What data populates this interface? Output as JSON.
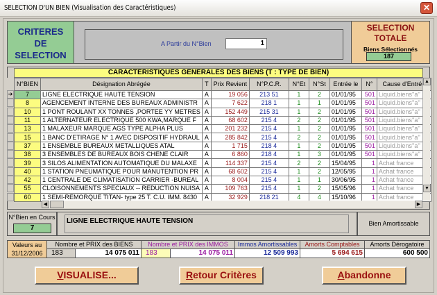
{
  "window": {
    "title": "SELECTION D'UN BIEN  (Visualisation des Caractéristiques)",
    "close_icon": "close-icon"
  },
  "criteria": {
    "title_lines": [
      "CRITERES",
      "DE",
      "SELECTION"
    ],
    "from_label": "A Partir du N°Bien",
    "from_value": "1"
  },
  "selection": {
    "title_lines": [
      "SELECTION",
      "TOTALE"
    ],
    "count_label": "Biens Sélectionnés",
    "count": "187"
  },
  "table": {
    "title": "CARACTERISTIQUES GENERALES DES BIENS (T : TYPE DE BIEN)",
    "columns": [
      "N°BIEN",
      "Désignation Abrégée",
      "T",
      "Prix Revient",
      "N°P.C.R.",
      "N°Et",
      "N°St",
      "Entrée le",
      "N°",
      "Cause d'Entrée"
    ],
    "rows": [
      [
        "7",
        "LIGNE ELECTRIQUE HAUTE TENSION",
        "A",
        "19 056",
        "213 51",
        "1",
        "2",
        "01/01/95",
        "501",
        "Liquid.biens''a''"
      ],
      [
        "8",
        "AGENCEMENT INTERNE DES BUREAUX ADMINISTR",
        "A",
        "7 622",
        "218 1",
        "1",
        "1",
        "01/01/95",
        "501",
        "Liquid.biens''a''"
      ],
      [
        "10",
        "1 PONT ROULANT XX TONNES ,PORTEE YY METRES",
        "A",
        "152 449",
        "215 31",
        "1",
        "2",
        "01/01/95",
        "501",
        "Liquid.biens''a''"
      ],
      [
        "11",
        "1 ALTERNATEUR  ELECTRIQUE 500 KWA,MARQUE F",
        "A",
        "68 602",
        "215 4",
        "2",
        "2",
        "01/01/95",
        "501",
        "Liquid.biens''a''"
      ],
      [
        "13",
        "1 MALAXEUR MARQUE AGS TYPE ALPHA PLUS",
        "A",
        "201 232",
        "215 4",
        "1",
        "2",
        "01/01/95",
        "501",
        "Liquid.biens''a''"
      ],
      [
        "15",
        "1 BANC D'ETIRAGE N° 1 AVEC DISPOSITIF HYDRAUL",
        "A",
        "285 842",
        "215 4",
        "2",
        "2",
        "01/01/95",
        "501",
        "Liquid.biens''a''"
      ],
      [
        "37",
        "1 ENSEMBLE BUREAUX METALLIQUES ATAL",
        "A",
        "1 715",
        "218 4",
        "1",
        "2",
        "01/01/95",
        "501",
        "Liquid.biens''a''"
      ],
      [
        "38",
        "3 ENSEMBLES DE BUREAUX BOIS CHENE CLAIR",
        "A",
        "6 860",
        "218 4",
        "1",
        "3",
        "01/01/95",
        "501",
        "Liquid.biens''a''"
      ],
      [
        "39",
        "3 SILOS ALIMENTATION AUTOMATIQUE DU MALAXE",
        "A",
        "114 337",
        "215 4",
        "2",
        "2",
        "15/04/95",
        "1",
        "Achat france"
      ],
      [
        "40",
        "1 STATION PNEUMATIQUE POUR MANUTENTION PR",
        "A",
        "68 602",
        "215 4",
        "1",
        "2",
        "12/05/95",
        "1",
        "Achat france"
      ],
      [
        "42",
        "1 CENTRALE DE CLIMATISATION CARRIER -BUREAL",
        "A",
        "8 004",
        "215 4",
        "1",
        "1",
        "30/06/95",
        "1",
        "Achat france"
      ],
      [
        "55",
        "CLOISONNEMENTS SPECIAUX  -- REDUCTION NUISA",
        "A",
        "109 763",
        "215 4",
        "1",
        "2",
        "15/05/96",
        "1",
        "Achat france"
      ],
      [
        "60",
        "1 SEMI-REMORQUE TITAN- type 25 T. C.U. IMM. 8430",
        "A",
        "32 929",
        "218 21",
        "4",
        "4",
        "15/10/96",
        "1",
        "Achat france"
      ]
    ]
  },
  "current": {
    "label": "N°Bien en Cours",
    "value": "7",
    "designation": "LIGNE ELECTRIQUE HAUTE TENSION",
    "status": "Bien Amortissable"
  },
  "values": {
    "date_lines": [
      "Valeurs au",
      "31/12/2006"
    ],
    "biens": {
      "header": "Nombre et PRIX des BIENS",
      "count": "183",
      "amount": "14 075 011"
    },
    "immos": {
      "header": "Nombre et PRIX des IMMOS",
      "count": "183",
      "amount": "14 075 011"
    },
    "amortissables": {
      "header": "Immos Amortissables",
      "amount": "12 509 993"
    },
    "comptables": {
      "header": "Amorts Comptables",
      "amount": "5 694 615"
    },
    "derogatoire": {
      "header": "Amorts Dérogatoire",
      "amount": "600 500"
    }
  },
  "buttons": {
    "visualise": {
      "first": "V",
      "rest": "ISUALISE..."
    },
    "retour": {
      "first": "R",
      "rest": "etour Critères"
    },
    "abandonne": {
      "first": "A",
      "rest": "bandonne"
    }
  },
  "colors": {
    "green": "#94cc94",
    "yellow": "#fcfc80",
    "orange": "#f0cc98",
    "red_text": "#9a1a1a",
    "blue_text": "#1a2a9a"
  }
}
